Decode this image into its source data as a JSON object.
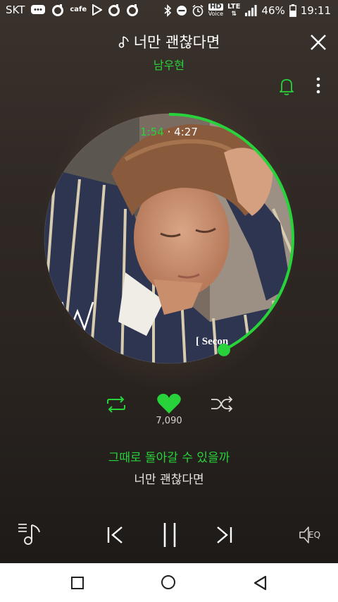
{
  "status_bar": {
    "carrier": "SKT",
    "cafe_label": "cafe",
    "hd_label": "HD",
    "voice_label": "Voice",
    "lte_label": "LTE",
    "battery": "46%",
    "time": "19:11"
  },
  "header": {
    "song_title": "너만 괜찮다면",
    "artist": "남우현"
  },
  "player": {
    "current_time": "1:54",
    "separator": "·",
    "total_time": "4:27",
    "progress": 0.427,
    "like_count": "7,090",
    "lyric_current": "그때로 돌아갈 수 있을까",
    "lyric_next": "너만 괜찮다면",
    "eq_label": "EQ"
  },
  "colors": {
    "accent": "#27d23a"
  },
  "icons": {
    "close": "close-icon",
    "bell": "bell-icon",
    "more": "more-vertical-icon",
    "repeat": "repeat-icon",
    "heart": "heart-icon",
    "shuffle": "shuffle-icon",
    "playlist": "playlist-icon",
    "prev": "skip-previous-icon",
    "pause": "pause-icon",
    "next": "skip-next-icon",
    "eq": "equalizer-icon"
  }
}
